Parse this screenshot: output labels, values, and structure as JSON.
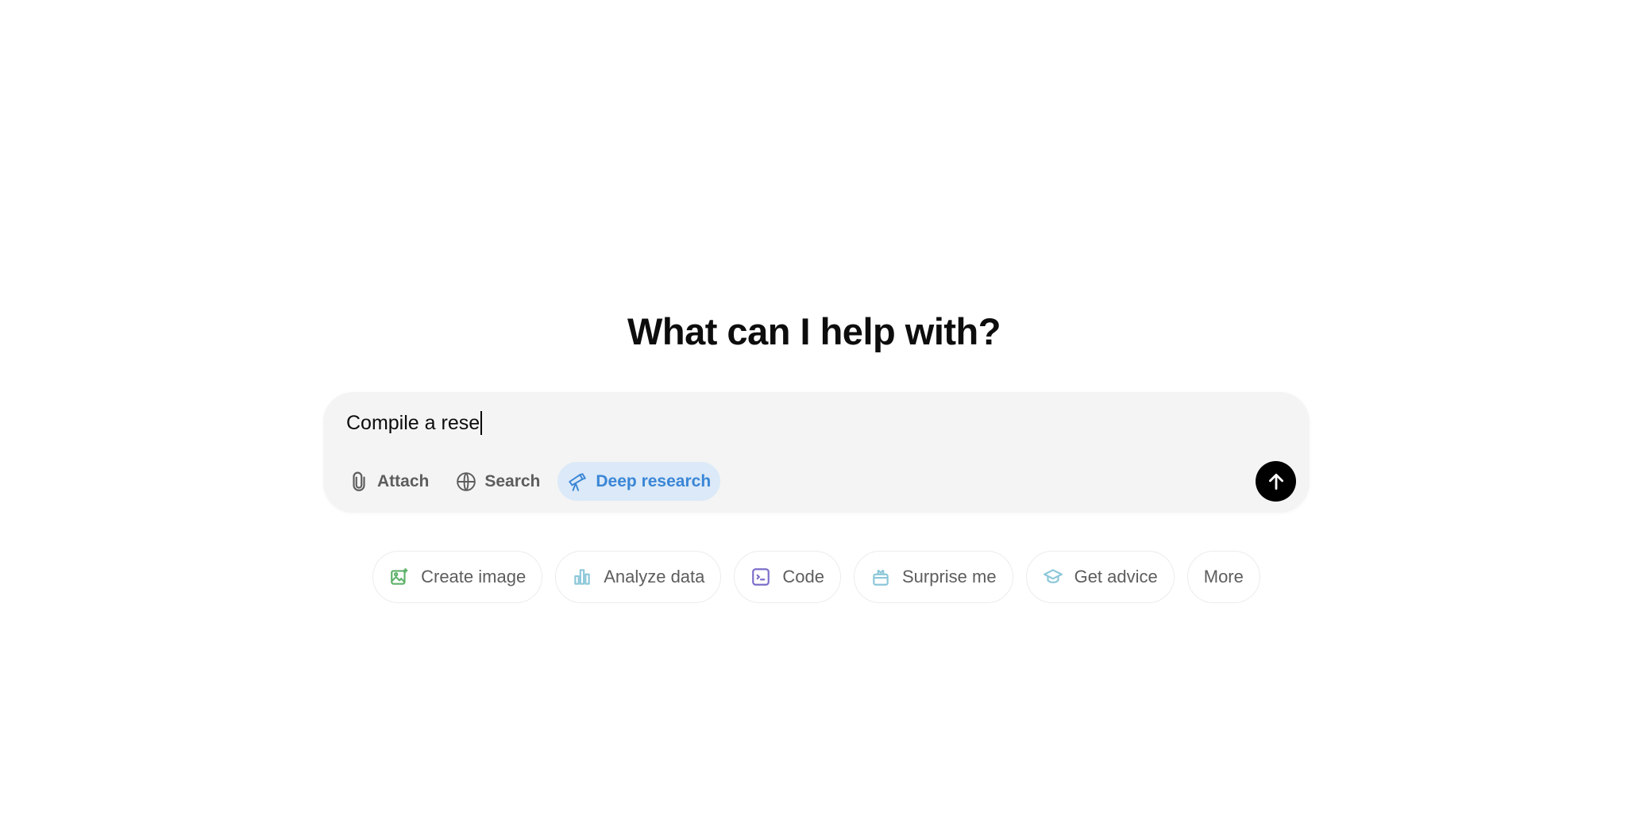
{
  "heading": "What can I help with?",
  "composer": {
    "input_value": "Compile a rese",
    "tools": [
      {
        "label": "Attach",
        "icon": "paperclip-icon"
      },
      {
        "label": "Search",
        "icon": "globe-icon"
      },
      {
        "label": "Deep research",
        "icon": "telescope-icon",
        "active": true
      }
    ],
    "send_icon": "arrow-up-icon"
  },
  "suggestions": [
    {
      "label": "Create image",
      "icon": "image-icon",
      "color": "#5fb26b"
    },
    {
      "label": "Analyze data",
      "icon": "bar-chart-icon",
      "color": "#8cc7d9"
    },
    {
      "label": "Code",
      "icon": "terminal-icon",
      "color": "#7a6fc9"
    },
    {
      "label": "Surprise me",
      "icon": "gift-icon",
      "color": "#8cc7d9"
    },
    {
      "label": "Get advice",
      "icon": "graduation-cap-icon",
      "color": "#8cc7d9"
    },
    {
      "label": "More"
    }
  ],
  "colors": {
    "accent": "#3a86d6",
    "accent_bg": "#dbe9f8",
    "composer_bg": "#f4f4f4"
  }
}
